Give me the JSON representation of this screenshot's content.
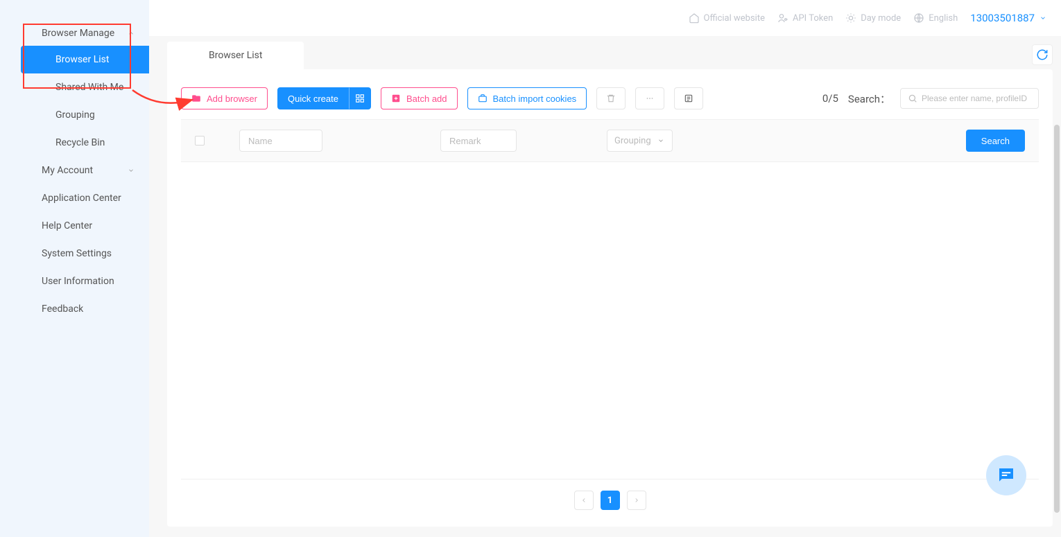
{
  "sidebar": {
    "browser_manage": "Browser Manage",
    "browser_list": "Browser List",
    "shared_with_me": "Shared With Me",
    "grouping": "Grouping",
    "recycle_bin": "Recycle Bin",
    "my_account": "My Account",
    "application_center": "Application Center",
    "help_center": "Help Center",
    "system_settings": "System Settings",
    "user_information": "User Information",
    "feedback": "Feedback"
  },
  "topbar": {
    "official_website": "Official website",
    "api_token": "API Token",
    "day_mode": "Day mode",
    "english": "English",
    "account_id": "13003501887"
  },
  "tabs": {
    "browser_list": "Browser List"
  },
  "toolbar": {
    "add_browser": "Add browser",
    "quick_create": "Quick create",
    "batch_add": "Batch add",
    "batch_import_cookies": "Batch import cookies",
    "counter": "0/5",
    "search_label": "Search：",
    "search_placeholder": "Please enter name, profileID"
  },
  "filters": {
    "name_placeholder": "Name",
    "remark_placeholder": "Remark",
    "grouping_placeholder": "Grouping",
    "search_button": "Search"
  },
  "pagination": {
    "current": "1"
  }
}
